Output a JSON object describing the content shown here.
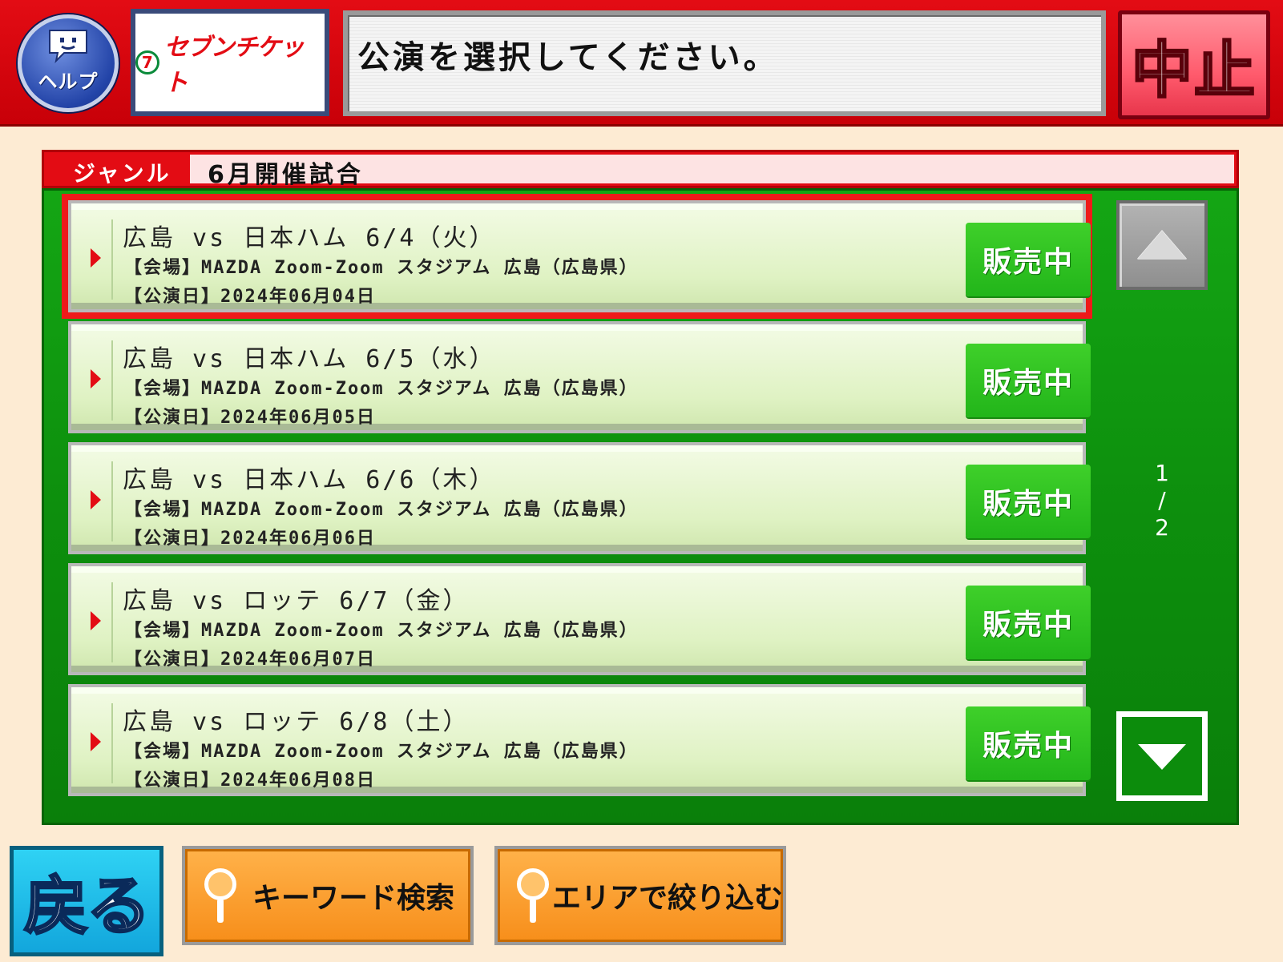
{
  "header": {
    "help_label": "ヘルプ",
    "logo_text": "セブンチケット",
    "logo_mark": "7",
    "message": "公演を選択してください。",
    "cancel_label": "中止"
  },
  "genre": {
    "label": "ジャンル",
    "value": "6月開催試合"
  },
  "events": [
    {
      "title": "広島 vs 日本ハム 6/4（火）",
      "venue": "【会場】MAZDA Zoom-Zoom スタジアム 広島（広島県）",
      "date": "【公演日】2024年06月04日",
      "status": "販売中",
      "selected": true
    },
    {
      "title": "広島 vs 日本ハム 6/5（水）",
      "venue": "【会場】MAZDA Zoom-Zoom スタジアム 広島（広島県）",
      "date": "【公演日】2024年06月05日",
      "status": "販売中",
      "selected": false
    },
    {
      "title": "広島 vs 日本ハム 6/6（木）",
      "venue": "【会場】MAZDA Zoom-Zoom スタジアム 広島（広島県）",
      "date": "【公演日】2024年06月06日",
      "status": "販売中",
      "selected": false
    },
    {
      "title": "広島 vs ロッテ 6/7（金）",
      "venue": "【会場】MAZDA Zoom-Zoom スタジアム 広島（広島県）",
      "date": "【公演日】2024年06月07日",
      "status": "販売中",
      "selected": false
    },
    {
      "title": "広島 vs ロッテ 6/8（土）",
      "venue": "【会場】MAZDA Zoom-Zoom スタジアム 広島（広島県）",
      "date": "【公演日】2024年06月08日",
      "status": "販売中",
      "selected": false
    }
  ],
  "pagination": {
    "current": "1",
    "separator": "/",
    "total": "2"
  },
  "footer": {
    "back_label": "戻る",
    "keyword_search_label": "キーワード検索",
    "area_filter_label": "エリアで絞り込む"
  },
  "icons": {
    "help": "help-face-icon",
    "scroll_up": "triangle-up-icon",
    "scroll_down": "triangle-down-icon",
    "search": "magnifier-icon",
    "row_marker": "caret-right-icon"
  },
  "colors": {
    "header_red": "#e30c14",
    "list_green": "#0d8f0d",
    "status_green": "#22b51a",
    "background": "#fdebd3"
  }
}
